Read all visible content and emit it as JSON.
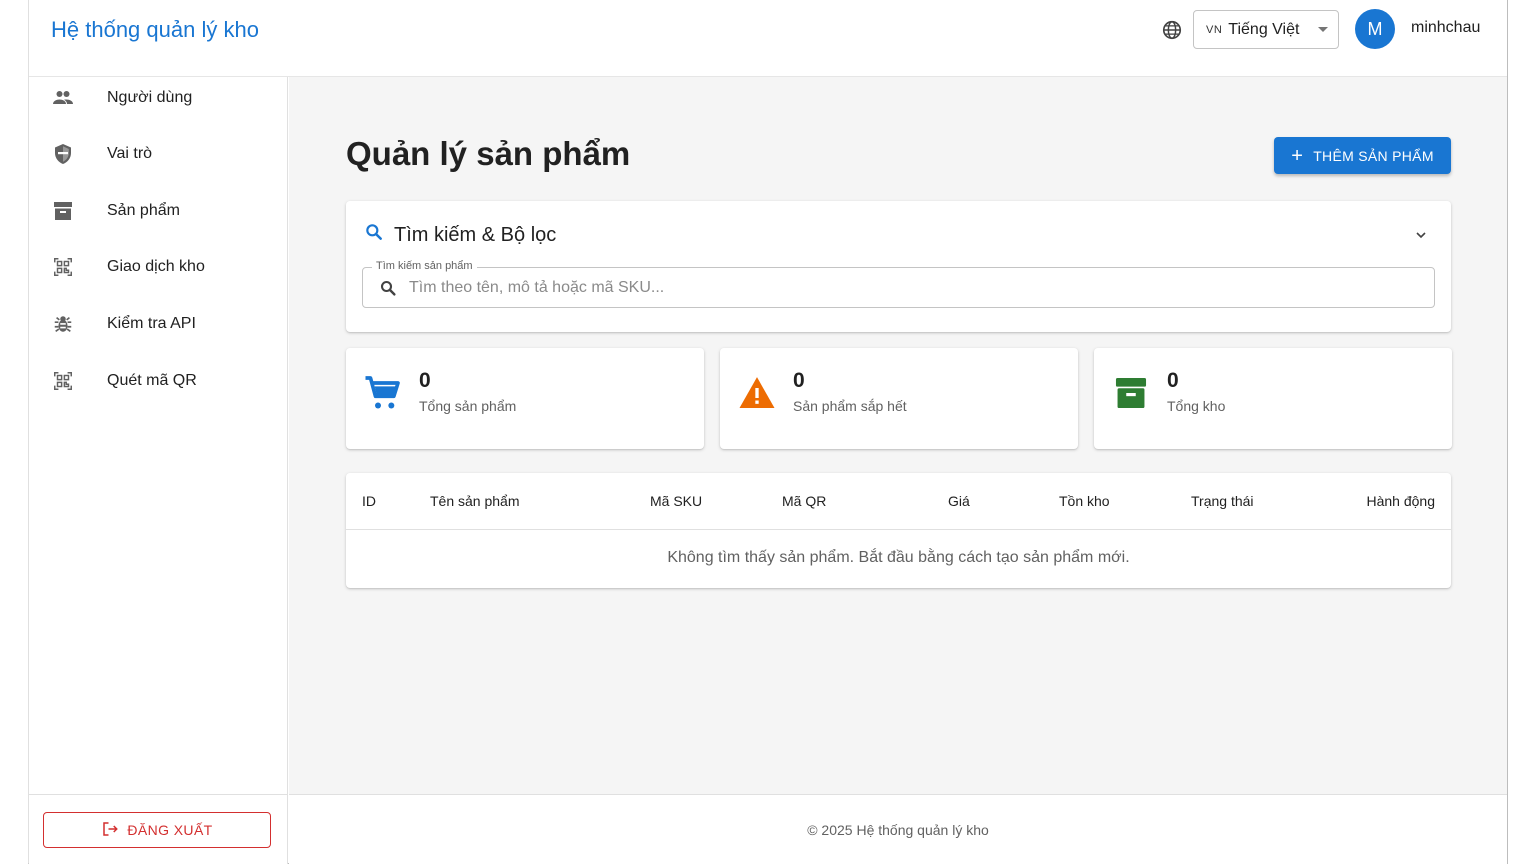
{
  "header": {
    "title": "Hệ thống quản lý kho",
    "language": {
      "flag": "VN",
      "label": "Tiếng Việt"
    },
    "user": {
      "initial": "M",
      "name": "minhchau"
    }
  },
  "sidebar": {
    "items": [
      {
        "label": "Người dùng",
        "icon": "people-icon"
      },
      {
        "label": "Vai trò",
        "icon": "shield-icon"
      },
      {
        "label": "Sản phẩm",
        "icon": "archive-icon"
      },
      {
        "label": "Giao dịch kho",
        "icon": "qr-scan-icon"
      },
      {
        "label": "Kiểm tra API",
        "icon": "bug-icon"
      },
      {
        "label": "Quét mã QR",
        "icon": "qr-scan-icon"
      }
    ],
    "logout_label": "ĐĂNG XUẤT"
  },
  "main": {
    "page_title": "Quản lý sản phẩm",
    "add_button_label": "THÊM SẢN PHẨM",
    "filter": {
      "title": "Tìm kiếm & Bộ lọc",
      "search_label": "Tìm kiếm sản phẩm",
      "search_placeholder": "Tìm theo tên, mô tả hoặc mã SKU...",
      "search_value": ""
    },
    "stats": [
      {
        "value": "0",
        "label": "Tổng sản phẩm",
        "icon": "cart-icon",
        "color": "#1976d2"
      },
      {
        "value": "0",
        "label": "Sản phẩm sắp hết",
        "icon": "warning-icon",
        "color": "#ed6c02"
      },
      {
        "value": "0",
        "label": "Tổng kho",
        "icon": "inventory-icon",
        "color": "#2e7d32"
      }
    ],
    "table": {
      "columns": [
        "ID",
        "Tên sản phẩm",
        "Mã SKU",
        "Mã QR",
        "Giá",
        "Tồn kho",
        "Trạng thái",
        "Hành động"
      ],
      "empty_message": "Không tìm thấy sản phẩm. Bắt đầu bằng cách tạo sản phẩm mới."
    }
  },
  "footer": {
    "text": "© 2025 Hệ thống quản lý kho"
  },
  "colors": {
    "primary": "#1976d2",
    "danger": "#d32f2f",
    "warning": "#ed6c02",
    "success": "#2e7d32",
    "background": "#f5f5f5"
  }
}
